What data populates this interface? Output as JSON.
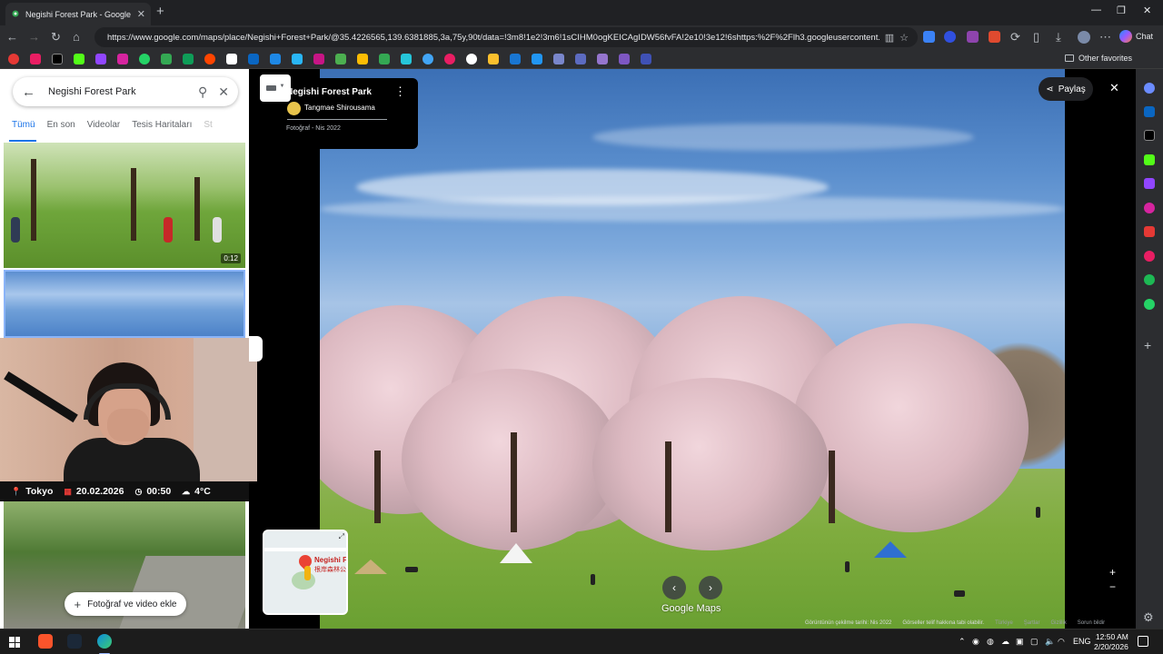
{
  "browser": {
    "tab_title": "Negishi Forest Park - Google Haritalar",
    "url": "https://www.google.com/maps/place/Negishi+Forest+Park/@35.4226565,139.6381885,3a,75y,90t/data=!3m8!1e2!3m6!1sCIHM0ogKEICAgIDW56fvFA!2e10!3e12!6shttps:%2F%2Flh3.googleusercontent.co...",
    "chat_label": "Chat",
    "other_favorites": "Other favorites",
    "accent_color": "#1a73e8"
  },
  "left_panel": {
    "search_query": "Negishi Forest Park",
    "tabs": [
      "Tümü",
      "En son",
      "Videolar",
      "Tesis Haritaları",
      "St"
    ],
    "active_tab": "Tümü",
    "video_duration": "0:12",
    "add_photo_label": "Fotoğraf ve video ekle"
  },
  "info_strip": {
    "city": "Tokyo",
    "date": "20.02.2026",
    "time": "00:50",
    "temperature": "4°C"
  },
  "photo_card": {
    "title": "Negishi Forest Park",
    "author": "Tangmae Shirousama",
    "meta": "Fotoğraf - Nis 2022"
  },
  "viewer": {
    "share_label": "Paylaş",
    "watermark": "Google Maps",
    "minimap_label_en": "Negishi F",
    "minimap_label_jp": "根岸森林公",
    "footer": {
      "capture_date": "Görüntünün çekilme tarihi: Nis 2022",
      "copyright": "Görseller telif hakkına tabi olabilir.",
      "country": "Türkiye",
      "terms": "Şartlar",
      "privacy": "Gizlilik",
      "report": "Sorun bildir"
    }
  },
  "taskbar": {
    "language": "ENG",
    "time": "12:50 AM",
    "date": "2/20/2026"
  }
}
